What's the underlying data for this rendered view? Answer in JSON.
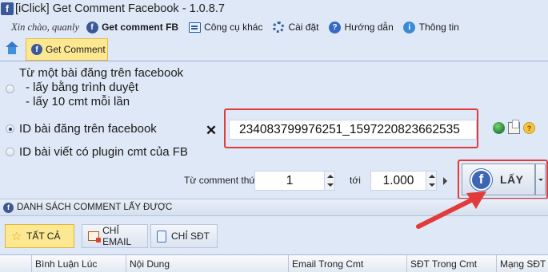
{
  "window": {
    "app_icon": "facebook-f",
    "title": "[iClick] Get Comment Facebook - 1.0.8.7"
  },
  "menubar": {
    "greeting": "Xin chào, quanly",
    "items": [
      {
        "label": "Get comment FB",
        "icon": "facebook-icon",
        "bold": true
      },
      {
        "label": "Công cụ khác",
        "icon": "tools-icon"
      },
      {
        "label": "Cài đặt",
        "icon": "gear-icon"
      },
      {
        "label": "Hướng dẫn",
        "icon": "help-icon"
      },
      {
        "label": "Thông tin",
        "icon": "info-icon"
      }
    ]
  },
  "tabs": {
    "home_icon": "home-icon",
    "active_label": "Get Comment"
  },
  "options": {
    "opt1": {
      "label": "Từ một bài đăng trên facebook",
      "sub1": "- lấy bằng trình duyệt",
      "sub2": "- lấy 10 cmt mỗi lần",
      "checked": false
    },
    "opt2": {
      "label": "ID bài đăng trên facebook",
      "checked": true
    },
    "opt3": {
      "label": "ID bài viết có plugin cmt của FB",
      "checked": false
    }
  },
  "post_id": {
    "clear_label": "✕",
    "value": "234083799976251_1597220823662535"
  },
  "range": {
    "from_label": "Từ comment thứ",
    "from_value": "1",
    "to_label": "tới",
    "to_value": "1.000"
  },
  "get_button": {
    "label": "LẤY"
  },
  "list": {
    "title": "DANH SÁCH COMMENT LẤY ĐƯỢC",
    "filters": [
      {
        "label": "TẤT CẢ",
        "active": true
      },
      {
        "label": "CHỈ EMAIL",
        "active": false
      },
      {
        "label": "CHỈ SĐT",
        "active": false
      }
    ],
    "columns": [
      "Bình Luận Lúc",
      "Nội Dung",
      "Email Trong Cmt",
      "SĐT Trong Cmt",
      "Mạng SĐT"
    ]
  },
  "colors": {
    "highlight_red": "#e23b3b",
    "active_tab": "#fde892",
    "facebook_blue": "#3b5998",
    "background": "#dfe8f6"
  }
}
